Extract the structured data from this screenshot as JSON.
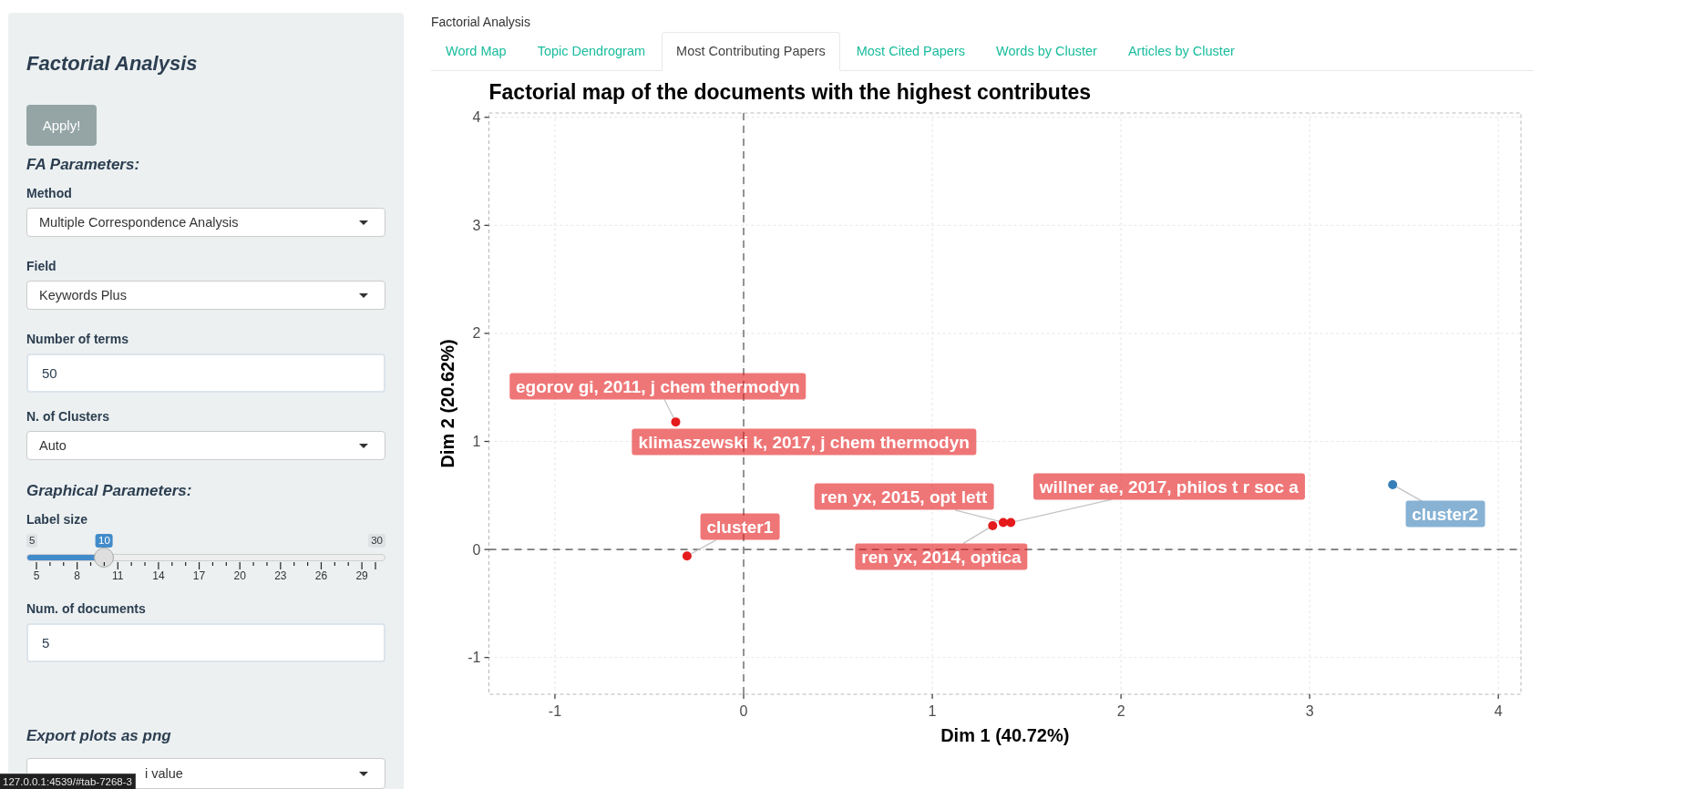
{
  "sidebar": {
    "title": "Factorial Analysis",
    "apply_button": "Apply!",
    "controls": [
      {
        "kind": "heading",
        "text": "FA Parameters:"
      },
      {
        "kind": "select",
        "label": "Method",
        "value": "Multiple Correspondence Analysis"
      },
      {
        "kind": "select",
        "label": "Field",
        "value": "Keywords Plus"
      },
      {
        "kind": "number",
        "label": "Number of terms",
        "value": "50"
      },
      {
        "kind": "select",
        "label": "N. of Clusters",
        "value": "Auto"
      },
      {
        "kind": "heading",
        "text": "Graphical Parameters:"
      },
      {
        "kind": "slider",
        "label": "Label size",
        "min": "5",
        "max": "30",
        "value": "10",
        "level": 0.2,
        "grid": [
          "5",
          "8",
          "11",
          "14",
          "17",
          "20",
          "23",
          "26",
          "29"
        ]
      },
      {
        "kind": "number",
        "label": "Num. of documents",
        "value": "5"
      }
    ],
    "export": {
      "heading": "Export plots as png",
      "select_value": "i value"
    }
  },
  "main": {
    "caption": "Factorial Analysis"
  },
  "tabs": [
    {
      "label": "Word Map",
      "selected": false
    },
    {
      "label": "Topic Dendrogram",
      "selected": false
    },
    {
      "label": "Most Contributing Papers",
      "selected": true
    },
    {
      "label": "Most Cited Papers",
      "selected": false
    },
    {
      "label": "Words by Cluster",
      "selected": false
    },
    {
      "label": "Articles by Cluster",
      "selected": false
    }
  ],
  "plot": {
    "chart_data": {
      "type": "scatter",
      "title": "Factorial map of the documents with the highest contributes",
      "xlabel": "Dim 1 (40.72%)",
      "ylabel": "Dim 2 (20.62%)",
      "xlim": [
        -1.35,
        4.12
      ],
      "ylim": [
        -1.34,
        4.04
      ],
      "xticks": [
        -1,
        0,
        1,
        2,
        3,
        4
      ],
      "yticks": [
        -1,
        0,
        1,
        2,
        3,
        4
      ],
      "grid": true,
      "x": [
        -0.36,
        1.32,
        1.376,
        1.416,
        -0.3,
        3.44
      ],
      "series": [
        {
          "color": "#e41a1c",
          "values": [
            1.18,
            0.22,
            0.25,
            0.25,
            -0.06,
            null
          ]
        },
        {
          "color": "#377eb8",
          "values": [
            null,
            null,
            null,
            null,
            null,
            0.6
          ]
        }
      ],
      "annotations": [
        {
          "text": "egorov gi, 2011, j chem thermodyn",
          "x": -0.36,
          "y": 1.18
        },
        {
          "text": "klimaszewski k, 2017, j chem thermodyn",
          "x": -0.36,
          "y": 1.18
        },
        {
          "text": "ren yx, 2015, opt lett",
          "x": 1.376,
          "y": 0.25
        },
        {
          "text": "willner ae, 2017, philos t r soc a",
          "x": 1.416,
          "y": 0.25
        },
        {
          "text": "cluster1",
          "x": -0.3,
          "y": -0.06
        },
        {
          "text": "ren yx, 2014, optica",
          "x": 1.32,
          "y": 0.22
        },
        {
          "text": "cluster2",
          "x": 3.44,
          "y": 0.6
        }
      ]
    }
  },
  "status_url": "127.0.0.1:4539/#tab-7268-3"
}
